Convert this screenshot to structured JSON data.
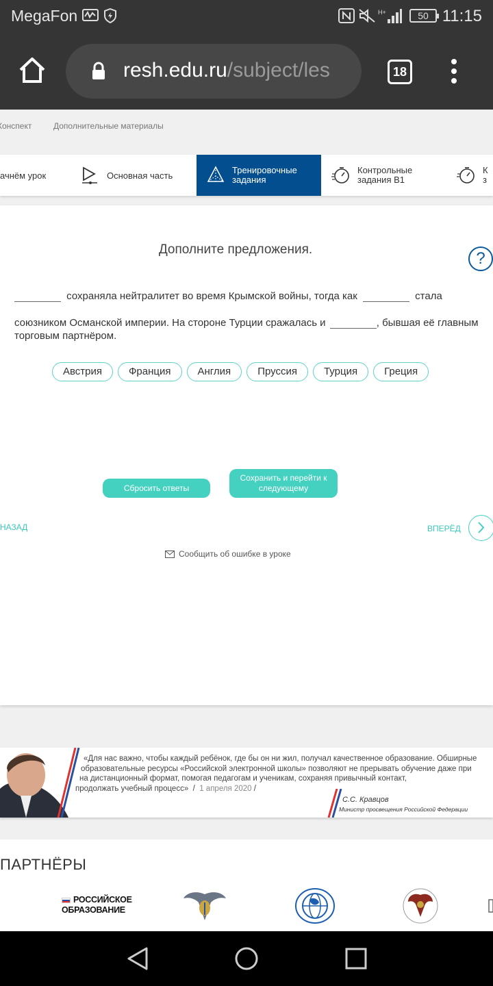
{
  "status_bar": {
    "carrier": "MegaFon",
    "battery": "50",
    "time": "11:15"
  },
  "browser": {
    "url_host": "resh.edu.ru",
    "url_path": "/subject/les",
    "tab_count": "18"
  },
  "subnav": {
    "items": [
      "Конспект",
      "Дополнительные материалы"
    ]
  },
  "steps": [
    {
      "label": "ачнём урок"
    },
    {
      "label": "Основная часть"
    },
    {
      "label": "Тренировочные задания",
      "active": true
    },
    {
      "label": "Контрольные задания В1"
    },
    {
      "label": "К з"
    }
  ],
  "task": {
    "title": "Дополните предложения.",
    "help": "?",
    "line1_a": "сохраняла нейтралитет во время Крымской войны, тогда как",
    "line1_b": "стала",
    "line2_a": "союзником Османской империи. На стороне Турции сражалась и",
    "line2_b": ", бывшая её главным",
    "line3": "торговым партнёром.",
    "options": [
      "Австрия",
      "Франция",
      "Англия",
      "Пруссия",
      "Турция",
      "Греция"
    ]
  },
  "actions": {
    "reset": "Сбросить ответы",
    "save": "Сохранить и перейти к следующему",
    "back": "НАЗАД",
    "forward": "ВПЕРЁД",
    "report": "Сообщить об ошибке в уроке"
  },
  "quote": {
    "line1": "«Для нас важно, чтобы каждый ребёнок, где бы он ни жил, получал качественное образование. Обширные",
    "line2": "образовательные ресурсы «Российской электронной школы» позволяют не прерывать обучение даже при",
    "line3": "на дистанционный формат, помогая педагогам и ученикам, сохраняя привычный контакт,",
    "line4": "продолжать учебный процесс»",
    "date": "1 апреля 2020",
    "author": "С.С. Кравцов",
    "author_title": "Министр просвещения Российской Федерации"
  },
  "partners": {
    "title": "ПАРТНЁРЫ",
    "ro_logo_line1": "РОССИЙСКОЕ",
    "ro_logo_line2": "ОБРАЗОВАНИЕ"
  },
  "colors": {
    "accent": "#45d1c0",
    "active_tab": "#034e8f",
    "chrome": "#353535"
  }
}
